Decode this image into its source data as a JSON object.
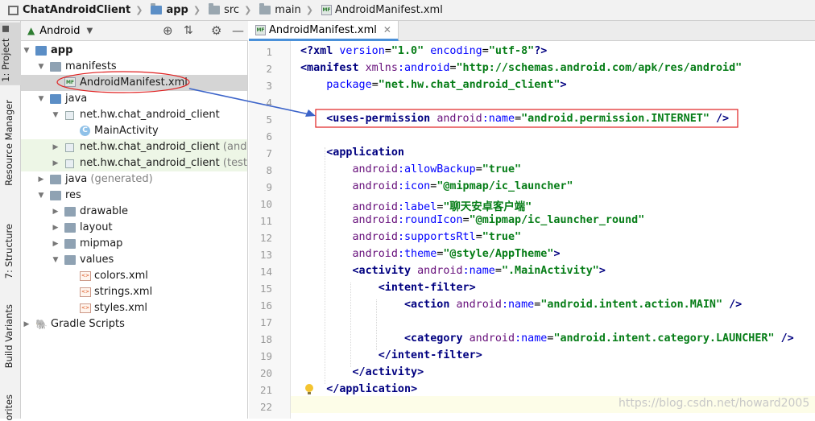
{
  "breadcrumb": [
    "ChatAndroidClient",
    "app",
    "src",
    "main",
    "AndroidManifest.xml"
  ],
  "toolstrip": {
    "project": "1: Project",
    "resource_manager": "Resource Manager",
    "structure": "7: Structure",
    "build_variants": "Build Variants",
    "favorites": "orites"
  },
  "panel": {
    "view_mode": "Android"
  },
  "tree": [
    {
      "label": "app",
      "suffix": ""
    },
    {
      "label": "manifests",
      "suffix": ""
    },
    {
      "label": "AndroidManifest.xml",
      "suffix": ""
    },
    {
      "label": "java",
      "suffix": ""
    },
    {
      "label": "net.hw.chat_android_client",
      "suffix": ""
    },
    {
      "label": "MainActivity",
      "suffix": ""
    },
    {
      "label": "net.hw.chat_android_client",
      "suffix": " (androidT"
    },
    {
      "label": "net.hw.chat_android_client",
      "suffix": " (test)"
    },
    {
      "label": "java",
      "suffix": " (generated)"
    },
    {
      "label": "res",
      "suffix": ""
    },
    {
      "label": "drawable",
      "suffix": ""
    },
    {
      "label": "layout",
      "suffix": ""
    },
    {
      "label": "mipmap",
      "suffix": ""
    },
    {
      "label": "values",
      "suffix": ""
    },
    {
      "label": "colors.xml",
      "suffix": ""
    },
    {
      "label": "strings.xml",
      "suffix": ""
    },
    {
      "label": "styles.xml",
      "suffix": ""
    },
    {
      "label": "Gradle Scripts",
      "suffix": ""
    }
  ],
  "editor": {
    "tab_label": "AndroidManifest.xml",
    "line_numbers": [
      "1",
      "2",
      "3",
      "4",
      "5",
      "6",
      "7",
      "8",
      "9",
      "10",
      "11",
      "12",
      "13",
      "14",
      "15",
      "16",
      "17",
      "18",
      "19",
      "20",
      "21",
      "22"
    ],
    "lines": [
      "<?xml version=\"1.0\" encoding=\"utf-8\"?>",
      "<manifest xmlns:android=\"http://schemas.android.com/apk/res/android\"",
      "    package=\"net.hw.chat_android_client\">",
      "",
      "    <uses-permission android:name=\"android.permission.INTERNET\" />",
      "",
      "    <application",
      "        android:allowBackup=\"true\"",
      "        android:icon=\"@mipmap/ic_launcher\"",
      "        android:label=\"聊天安卓客户端\"",
      "        android:roundIcon=\"@mipmap/ic_launcher_round\"",
      "        android:supportsRtl=\"true\"",
      "        android:theme=\"@style/AppTheme\">",
      "        <activity android:name=\".MainActivity\">",
      "            <intent-filter>",
      "                <action android:name=\"android.intent.action.MAIN\" />",
      "",
      "                <category android:name=\"android.intent.category.LAUNCHER\" />",
      "            </intent-filter>",
      "        </activity>",
      "    </application>",
      ""
    ]
  },
  "watermark": "https://blog.csdn.net/howard2005",
  "colors": {
    "tag": "#000080",
    "attribute": "#0000ff",
    "namespace": "#660e7a",
    "string": "#067d17",
    "annotation": "#e02020",
    "arrow": "#3b63c9"
  }
}
